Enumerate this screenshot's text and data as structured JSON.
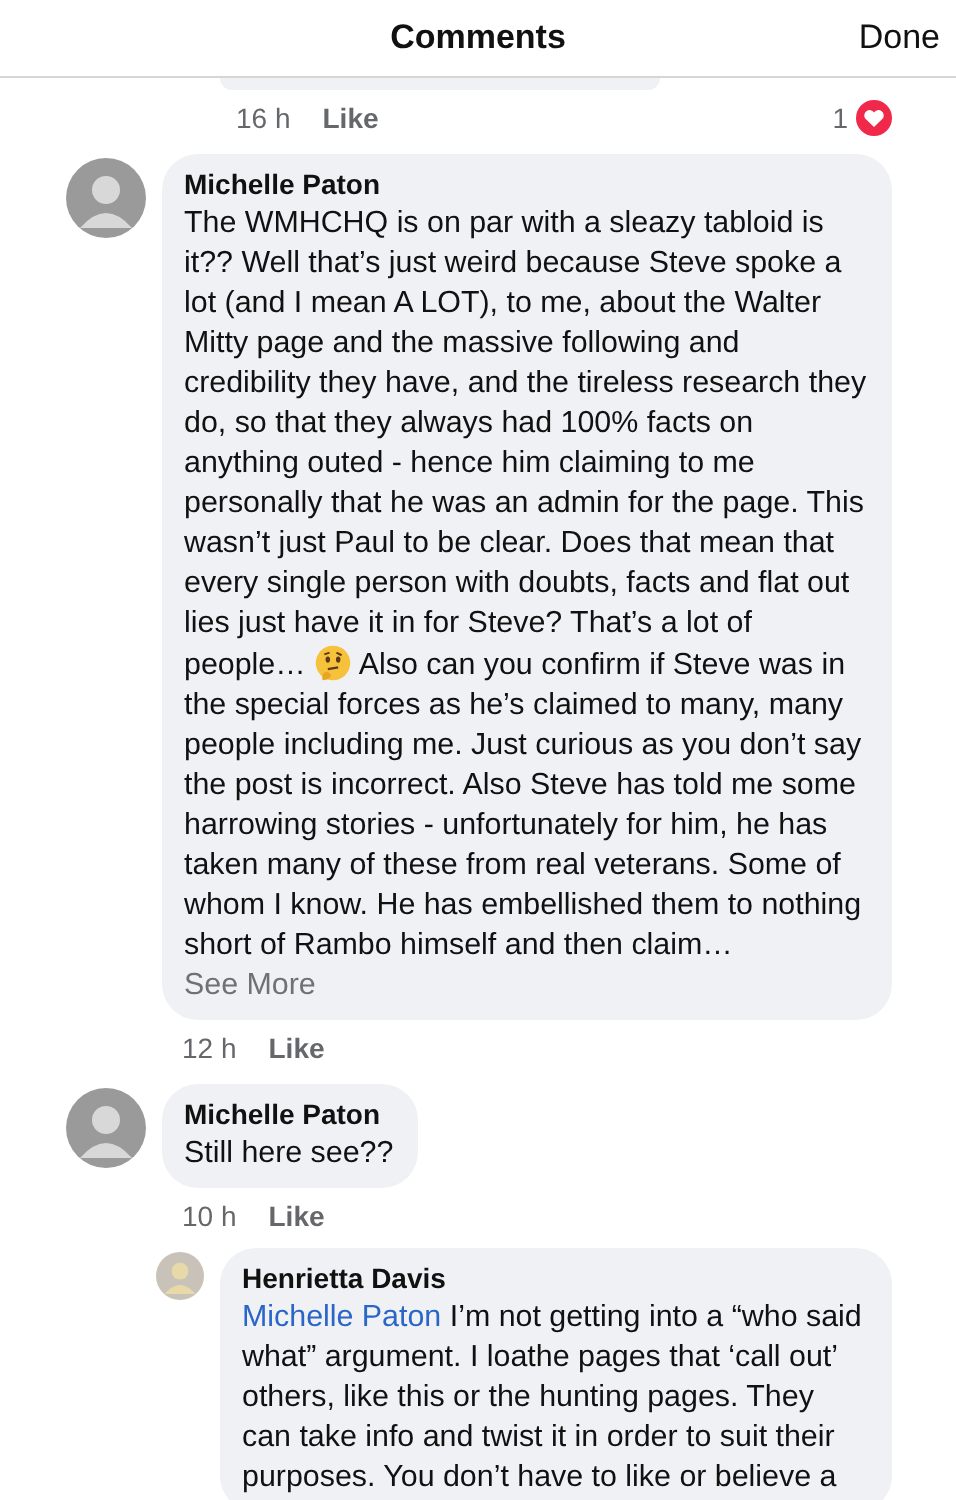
{
  "header": {
    "title": "Comments",
    "done": "Done"
  },
  "comments": [
    {
      "kind": "cutoff",
      "time": "16 h",
      "like": "Like",
      "reactions": "1"
    },
    {
      "kind": "comment",
      "author": "Michelle Paton",
      "segments": [
        {
          "kind": "text",
          "text": "The WMHCHQ is on par with a sleazy tabloid is it?? Well that’s just weird because Steve spoke a lot (and I mean A LOT), to me, about the Walter Mitty page and the massive following and credibility they have, and the tireless research they do, so that they always had 100% facts on anything outed - hence him claiming to me personally that he was an admin for the page. This wasn’t just Paul to be clear. Does that mean that every single person with doubts, facts and flat out lies just have it in for Steve? That’s a lot of people…"
        },
        {
          "kind": "emoji"
        },
        {
          "kind": "text",
          "text": "Also can you confirm if Steve was in the special forces as he’s claimed to many, many people including me. Just curious as you don’t say the post is incorrect. Also Steve has told me some harrowing stories - unfortunately for him, he has taken many of these from real veterans. Some of whom I know. He has embellished them to nothing short of Rambo himself and then claim…"
        },
        {
          "kind": "link",
          "text": "See More"
        }
      ],
      "time": "12 h",
      "like": "Like"
    },
    {
      "kind": "comment",
      "author": "Michelle Paton",
      "segments": [
        {
          "kind": "text",
          "text": "Still here see??"
        }
      ],
      "time": "10 h",
      "like": "Like"
    },
    {
      "kind": "reply",
      "author": "Henrietta Davis",
      "segments": [
        {
          "kind": "mention",
          "text": "Michelle Paton"
        },
        {
          "kind": "text",
          "text": "I’m not getting into a “who said what” argument. I loathe pages that ‘call out’ others, like this or the hunting pages. They can take info and twist it in order to suit their purposes. You don’t have to like or believe a"
        }
      ]
    }
  ]
}
